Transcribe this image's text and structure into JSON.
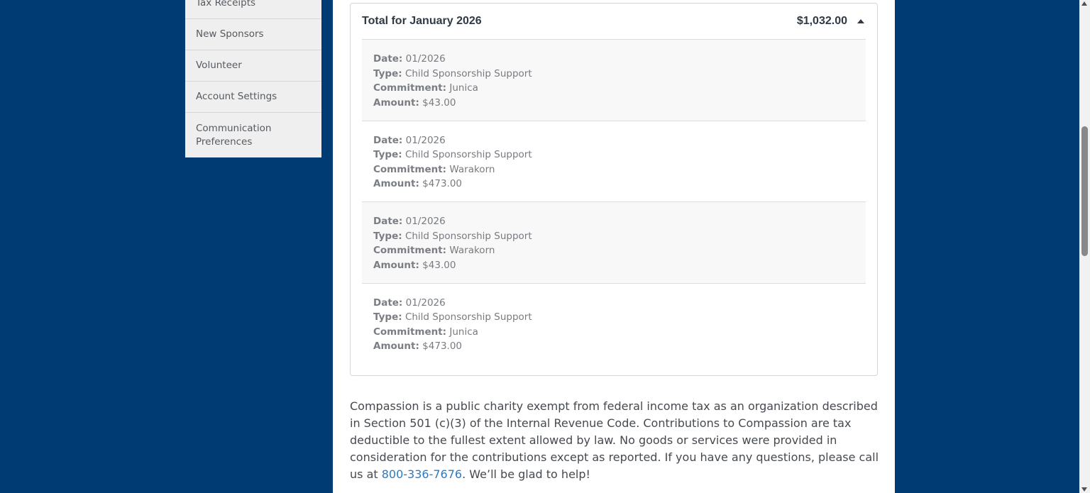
{
  "sidebar": {
    "items": [
      {
        "label": "Tax Receipts"
      },
      {
        "label": "New Sponsors"
      },
      {
        "label": "Volunteer"
      },
      {
        "label": "Account Settings"
      },
      {
        "label": "Communication Preferences"
      }
    ]
  },
  "summary": {
    "title": "Total for January 2026",
    "total": "$1,032.00",
    "labels": {
      "date": "Date:",
      "type": "Type:",
      "commitment": "Commitment:",
      "amount": "Amount:"
    },
    "entries": [
      {
        "date": "01/2026",
        "type": "Child Sponsorship Support",
        "commitment": "Junica",
        "amount": "$43.00"
      },
      {
        "date": "01/2026",
        "type": "Child Sponsorship Support",
        "commitment": "Warakorn",
        "amount": "$473.00"
      },
      {
        "date": "01/2026",
        "type": "Child Sponsorship Support",
        "commitment": "Warakorn",
        "amount": "$43.00"
      },
      {
        "date": "01/2026",
        "type": "Child Sponsorship Support",
        "commitment": "Junica",
        "amount": "$473.00"
      }
    ]
  },
  "disclaimer": {
    "text_before": "Compassion is a public charity exempt from federal income tax as an organization described in Section 501 (c)(3) of the Internal Revenue Code. Contributions to Compassion are tax deductible to the fullest extent allowed by law. No goods or services were provided in consideration for the contributions except as reported. If you have any questions, please call us at ",
    "phone": "800-336-7676",
    "text_after": ". We’ll be glad to help!"
  },
  "colors": {
    "page_background": "#003b73",
    "link": "#2a7bc0"
  }
}
